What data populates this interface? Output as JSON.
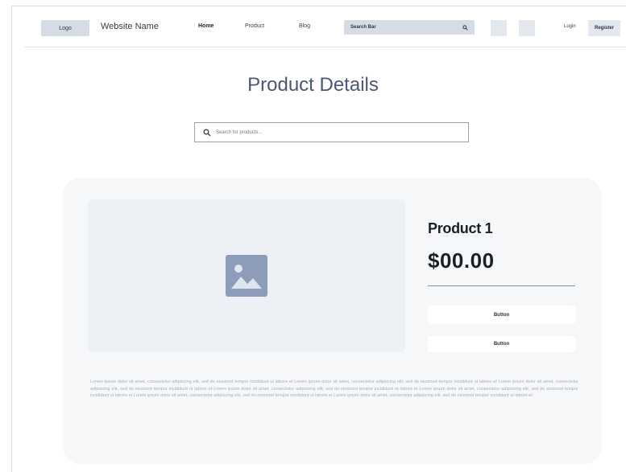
{
  "nav": {
    "logo": "Logo",
    "site_name": "Website Name",
    "links": [
      "Home",
      "Product",
      "Blog"
    ],
    "search_label": "Search Bar",
    "login": "Login",
    "register": "Register"
  },
  "page": {
    "title": "Product Details",
    "search_placeholder": "Search for products..."
  },
  "product": {
    "name": "Product 1",
    "price": "$00.00",
    "button_1": "Button",
    "button_2": "Button",
    "description": "Lorem ipsum dolor sit amet, consectetur adipiscing elit, sed do eiusmod tempor incididunt ut labore et Lorem ipsum dolor sit amet, consectetur adipiscing elit, sed do eiusmod tempor incididunt ut labore et Lorem ipsum dolor sit amet, consectetur adipiscing elit, sed do eiusmod tempor incididunt ut labore et Lorem ipsum dolor sit amet, consectetur adipiscing elit, sed do eiusmod tempor incididunt ut labore et Lorem ipsum dolor sit amet, consectetur adipiscing elit, sed do eiusmod tempor incididunt ut labore et Lorem ipsum dolor sit amet, consectetur adipiscing elit, sed do eiusmod tempor incididunt ut labore et Lorem ipsum dolor sit amet, consectetur adipiscing elit, sed do eiusmod tempor incididunt ut labore et"
  },
  "icons": {
    "search": "search-icon",
    "image_placeholder": "image-icon"
  },
  "colors": {
    "accent": "#4b5874",
    "image_icon": "#8d9cb8"
  }
}
